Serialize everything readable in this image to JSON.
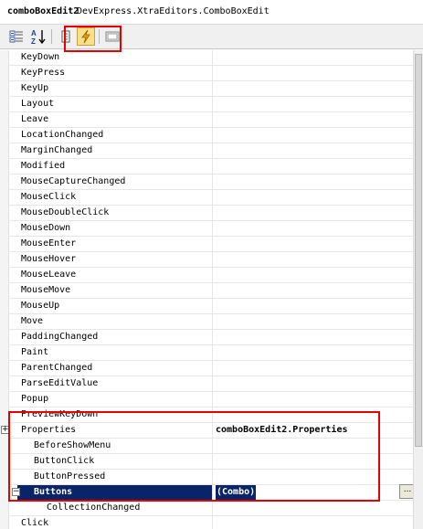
{
  "header": {
    "object_name": "comboBoxEdit2",
    "object_type": "DevExpress.XtraEditors.ComboBoxEdit"
  },
  "toolbar": {
    "buttons": [
      {
        "name": "categorized",
        "icon": "categorized-icon",
        "active": false
      },
      {
        "name": "alphabetical",
        "icon": "alphabetical-az-icon",
        "active": false
      },
      {
        "name": "properties",
        "icon": "properties-icon",
        "active": false
      },
      {
        "name": "events",
        "icon": "lightning-events-icon",
        "active": true
      },
      {
        "name": "property-pages",
        "icon": "property-pages-icon",
        "active": false
      }
    ],
    "highlight_color": "#e60000"
  },
  "grid": {
    "rows": [
      {
        "label": "KeyDown",
        "value": ""
      },
      {
        "label": "KeyPress",
        "value": ""
      },
      {
        "label": "KeyUp",
        "value": ""
      },
      {
        "label": "Layout",
        "value": ""
      },
      {
        "label": "Leave",
        "value": ""
      },
      {
        "label": "LocationChanged",
        "value": ""
      },
      {
        "label": "MarginChanged",
        "value": ""
      },
      {
        "label": "Modified",
        "value": ""
      },
      {
        "label": "MouseCaptureChanged",
        "value": ""
      },
      {
        "label": "MouseClick",
        "value": ""
      },
      {
        "label": "MouseDoubleClick",
        "value": ""
      },
      {
        "label": "MouseDown",
        "value": ""
      },
      {
        "label": "MouseEnter",
        "value": ""
      },
      {
        "label": "MouseHover",
        "value": ""
      },
      {
        "label": "MouseLeave",
        "value": ""
      },
      {
        "label": "MouseMove",
        "value": ""
      },
      {
        "label": "MouseUp",
        "value": ""
      },
      {
        "label": "Move",
        "value": ""
      },
      {
        "label": "PaddingChanged",
        "value": ""
      },
      {
        "label": "Paint",
        "value": ""
      },
      {
        "label": "ParentChanged",
        "value": ""
      },
      {
        "label": "ParseEditValue",
        "value": ""
      },
      {
        "label": "Popup",
        "value": ""
      },
      {
        "label": "PreviewKeyDown",
        "value": ""
      },
      {
        "label": "Properties",
        "value": "comboBoxEdit2.Properties",
        "expander": "+"
      },
      {
        "label": "BeforeShowMenu",
        "value": ""
      },
      {
        "label": "ButtonClick",
        "value": ""
      },
      {
        "label": "ButtonPressed",
        "value": ""
      },
      {
        "label": "Buttons",
        "value": "(Combo)",
        "expander": "−",
        "selected": true
      },
      {
        "label": "CollectionChanged",
        "value": ""
      },
      {
        "label": "Click",
        "value": ""
      }
    ],
    "ellipsis_label": "...",
    "selection_color": "#0a246a",
    "highlight_color": "#e60000"
  }
}
